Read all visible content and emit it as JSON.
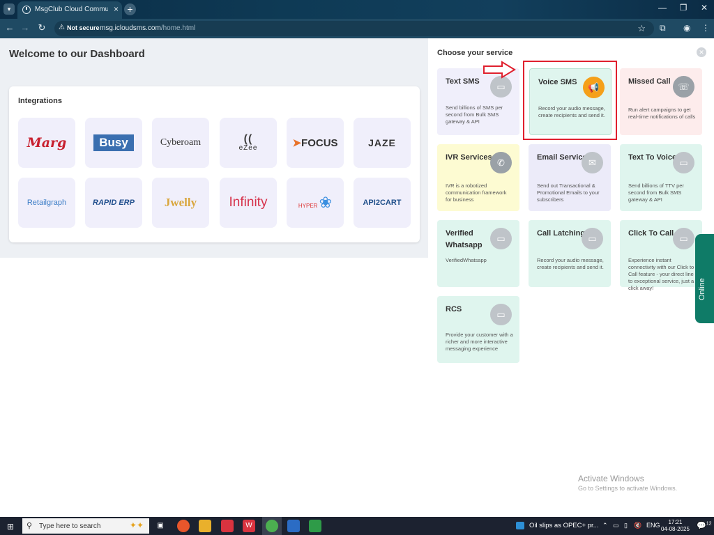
{
  "browser": {
    "tab_title": "MsgClub Cloud Communication",
    "tab_close": "×",
    "new_tab": "+",
    "security_label": "Not secure",
    "url_host": "msg.icloudsms.com",
    "url_path": "/home.html"
  },
  "page": {
    "welcome": "Welcome to our Dashboard",
    "integrations_title": "Integrations",
    "services_title": "Choose your service"
  },
  "integrations": [
    {
      "name": "Marg",
      "label": "Marg"
    },
    {
      "name": "Busy",
      "label": "Busy"
    },
    {
      "name": "Cyberoam",
      "label": "Cyberoam"
    },
    {
      "name": "eZee",
      "label": "eZee"
    },
    {
      "name": "Focus",
      "label": "FOCUS"
    },
    {
      "name": "Jaze",
      "label": "JAZE"
    },
    {
      "name": "Retailgraph",
      "label": "Retailgraph"
    },
    {
      "name": "Rapid ERP",
      "label": "RAPID ERP"
    },
    {
      "name": "Jwelly",
      "label": "Jwelly"
    },
    {
      "name": "Infinity",
      "label": "Infinity"
    },
    {
      "name": "Hyper",
      "label": "HYPER"
    },
    {
      "name": "API2Cart",
      "label": "API2CART"
    }
  ],
  "services": [
    {
      "name": "Text SMS",
      "desc": "Send billions of SMS per second from Bulk SMS gateway & API",
      "color": "#f0effb"
    },
    {
      "name": "Voice SMS",
      "desc": "Record your audio message, create recipients and send it.",
      "color": "#dff5ee"
    },
    {
      "name": "Missed Call",
      "desc": "Run alert campaigns to get real-time notifications of calls",
      "color": "#fdecec"
    },
    {
      "name": "IVR Services",
      "desc": "IVR is a robotized communication framework for business",
      "color": "#fdfbd2"
    },
    {
      "name": "Email Service",
      "desc": "Send out Transactional & Promotional Emails to your subscribers",
      "color": "#ecebf9"
    },
    {
      "name": "Text To Voice",
      "desc": "Send billions of TTV per second from Bulk SMS gateway & API",
      "color": "#dff5ee"
    },
    {
      "name": "Verified Whatsapp",
      "desc": "VerifiedWhatsapp",
      "color": "#dff5ee"
    },
    {
      "name": "Call Latching",
      "desc": "Record your audio message, create recipients and send it.",
      "color": "#dff5ee"
    },
    {
      "name": "Click To Call",
      "desc": "Experience instant connectivity with our Click to Call feature - your direct line to exceptional service, just a click away!",
      "color": "#dff5ee"
    },
    {
      "name": "RCS",
      "desc": "Provide your customer with a richer and more interactive messaging experience",
      "color": "#dff5ee"
    }
  ],
  "widget": {
    "online": "Online"
  },
  "watermark": {
    "title": "Activate Windows",
    "subtitle": "Go to Settings to activate Windows."
  },
  "taskbar": {
    "search_placeholder": "Type here to search",
    "news": "Oil slips as OPEC+ pr...",
    "lang": "ENG",
    "time": "17:21",
    "date": "04-08-2025",
    "notifications": "12"
  },
  "colors": {
    "accent": "#f5a01a",
    "highlight": "#e0202e",
    "online": "#0f7b67"
  }
}
